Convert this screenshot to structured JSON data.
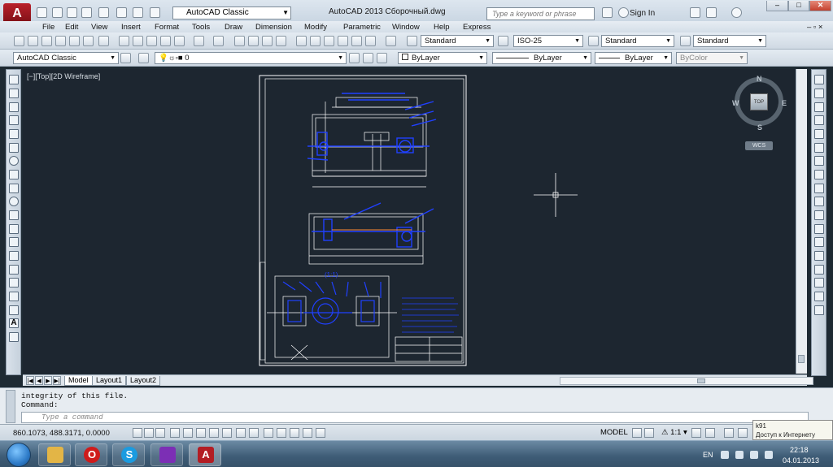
{
  "titlebar": {
    "app_logo_letter": "A",
    "workspace": "AutoCAD Classic",
    "window_title": "AutoCAD 2013    Сборочный.dwg",
    "search_placeholder": "Type a keyword or phrase",
    "sign_in": "Sign In"
  },
  "menu": [
    "File",
    "Edit",
    "View",
    "Insert",
    "Format",
    "Tools",
    "Draw",
    "Dimension",
    "Modify",
    "Parametric",
    "Window",
    "Help",
    "Express"
  ],
  "styles": {
    "text_style": "Standard",
    "dim_style": "ISO-25",
    "table_style": "Standard",
    "multileader_style": "Standard"
  },
  "layers": {
    "workspace": "AutoCAD Classic",
    "current_layer": "0",
    "color": "ByLayer",
    "linetype": "ByLayer",
    "lineweight": "ByLayer",
    "plot_style": "ByColor"
  },
  "viewport": {
    "label": "[−][Top][2D Wireframe]",
    "compass": {
      "n": "N",
      "s": "S",
      "e": "E",
      "w": "W"
    },
    "cube_face": "TOP",
    "ucs": "WCS"
  },
  "drawing": {
    "scale_note": "(1:1)"
  },
  "tabs": [
    {
      "label": "Model",
      "active": true
    },
    {
      "label": "Layout1",
      "active": false
    },
    {
      "label": "Layout2",
      "active": false
    }
  ],
  "command": {
    "history": [
      "integrity of this file.",
      "Command:"
    ],
    "placeholder": "Type a command"
  },
  "statusbar": {
    "coords": "860.1073, 488.3171, 0.0000",
    "model": "MODEL",
    "scale": "1:1"
  },
  "tooltip": {
    "line1": "k91",
    "line2": "Доступ к Интернету"
  },
  "taskbar": {
    "lang": "EN",
    "time": "22:18",
    "date": "04.01.2013"
  },
  "colors": {
    "canvas": "#1d2630",
    "drawing_blue": "#2040ff",
    "drawing_white": "#ffffff",
    "drawing_orange": "#ff8a30"
  }
}
